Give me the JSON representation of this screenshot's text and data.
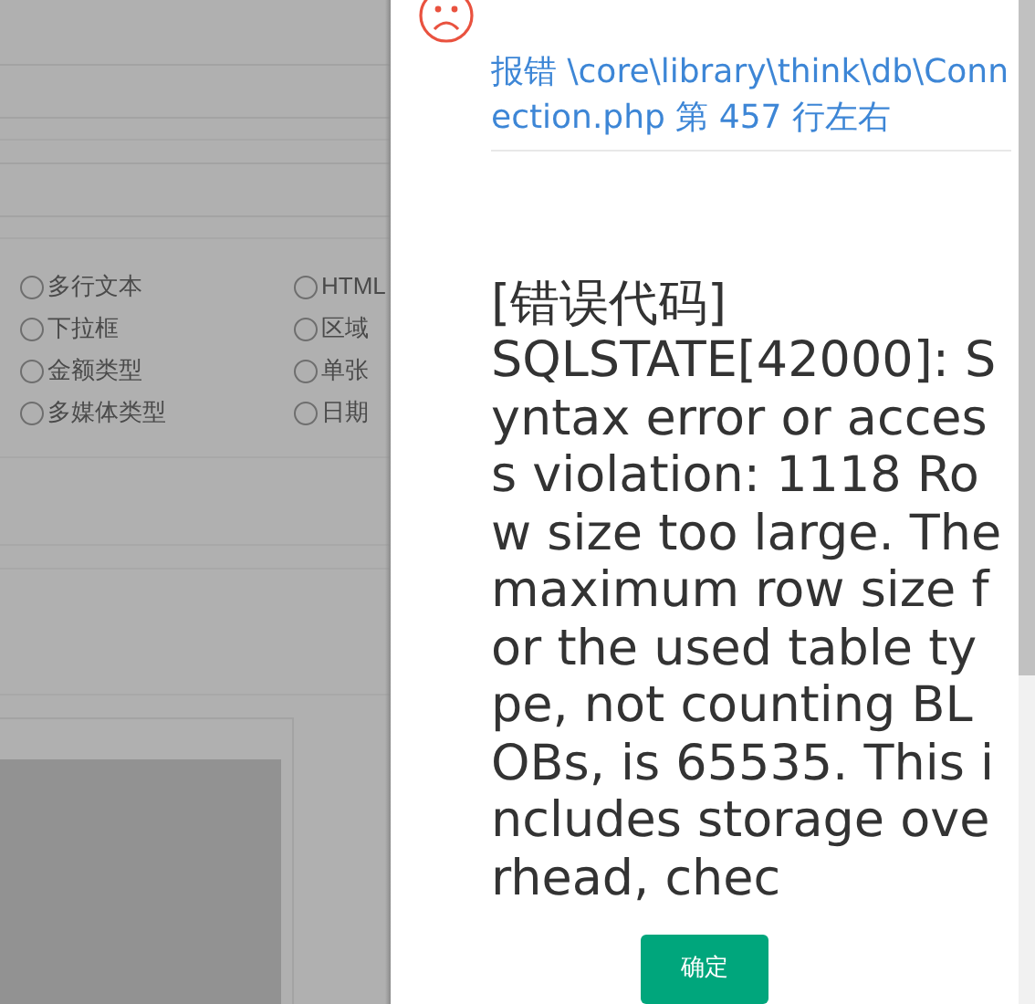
{
  "background": {
    "radio_options": [
      {
        "label": "多行文本",
        "selected": false
      },
      {
        "label": "HTML",
        "selected": false
      },
      {
        "label": "下拉框",
        "selected": false
      },
      {
        "label": "区域",
        "selected": false
      },
      {
        "label": "金额类型",
        "selected": false
      },
      {
        "label": "单张",
        "selected": false
      },
      {
        "label": "多媒体类型",
        "selected": false
      },
      {
        "label": "日期",
        "selected": false
      }
    ]
  },
  "error_dialog": {
    "location": "报错 \\core\\library\\think\\db\\Connection.php 第 457 行左右",
    "code_label": "[错误代码]",
    "message": "SQLSTATE[42000]: Syntax error or access violation: 1118 Row size too large. The maximum row size for the used table type, not counting BLOBs, is 65535. This includes storage overhead, chec",
    "button": "确定"
  }
}
